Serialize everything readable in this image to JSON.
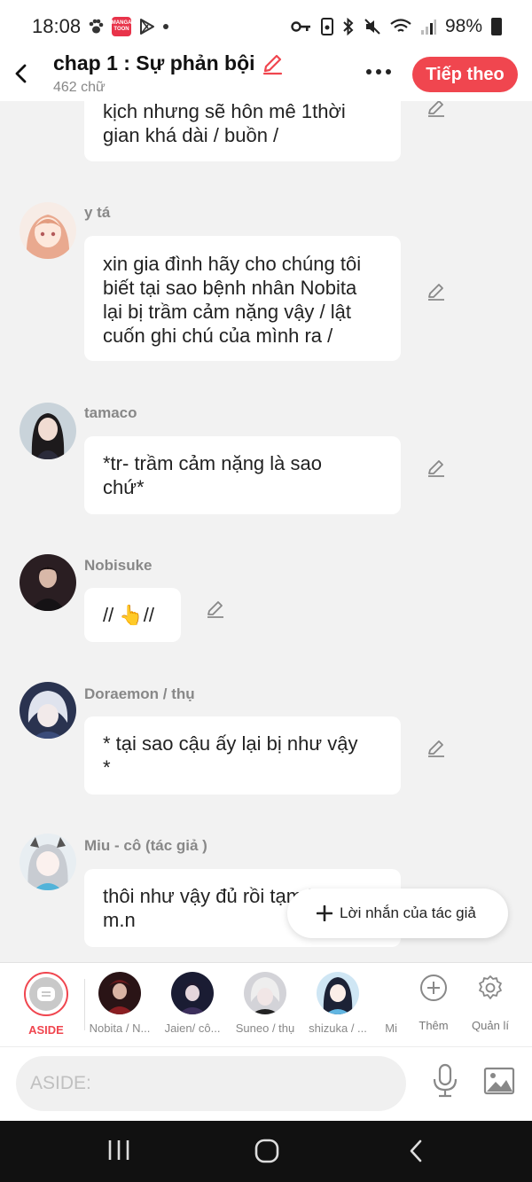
{
  "status": {
    "time": "18:08",
    "battery": "98%",
    "app_badge": "MANGA TOON"
  },
  "header": {
    "title": "chap 1 : Sự phản bội",
    "subtitle": "462 chữ",
    "next_label": "Tiếp theo",
    "accent": "#f0464f"
  },
  "messages": [
    {
      "name": "",
      "text_lines": [
        "kịch nhưng sẽ hôn mê 1thời",
        "gian khá dài / buồn /"
      ]
    },
    {
      "name": "y tá",
      "text_lines": [
        "xin gia đình hãy cho chúng tôi",
        "biết tại sao bệnh nhân  Nobita",
        "lại bị trầm cảm nặng vậy / lật",
        "cuốn ghi chú của mình ra /"
      ]
    },
    {
      "name": "tamaco",
      "text_lines": [
        "*tr- trầm cảm nặng là sao",
        "chứ*"
      ]
    },
    {
      "name": "Nobisuke",
      "text_lines": [
        "// 👆//"
      ]
    },
    {
      "name": "Doraemon / thụ",
      "text_lines": [
        "* tại sao cậu ấy lại bị như vậy",
        "*"
      ]
    },
    {
      "name": "Miu - cô (tác giả )",
      "text_lines": [
        "thôi như vậy đủ rồi tạm biệt",
        "m.n"
      ]
    }
  ],
  "author_message_button": "Lời nhắn của tác giả",
  "characters": {
    "aside_label": "ASIDE",
    "items": [
      {
        "label": "Nobita / N..."
      },
      {
        "label": "Jaien/ cô..."
      },
      {
        "label": "Suneo / thụ"
      },
      {
        "label": "shizuka / ..."
      },
      {
        "label": "Mi"
      }
    ],
    "add_label": "Thêm",
    "manage_label": "Quản lí"
  },
  "input": {
    "placeholder": "ASIDE:"
  }
}
